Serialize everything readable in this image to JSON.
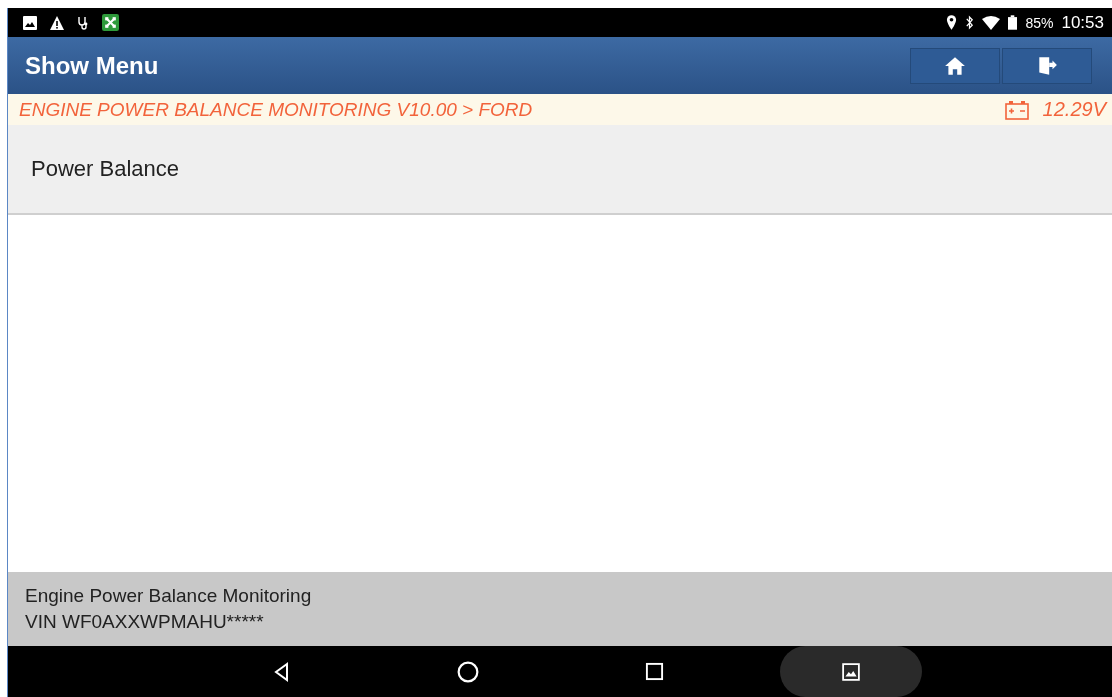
{
  "status_bar": {
    "battery": "85%",
    "time": "10:53"
  },
  "header": {
    "title": "Show Menu"
  },
  "breadcrumb": {
    "path": "ENGINE POWER BALANCE MONITORING V10.00 > FORD",
    "voltage": "12.29V"
  },
  "menu": {
    "items": [
      {
        "label": "Power Balance",
        "selected": false
      }
    ]
  },
  "footer": {
    "lines": [
      "Engine Power Balance Monitoring",
      "VIN WF0AXXWPMAHU*****"
    ]
  }
}
